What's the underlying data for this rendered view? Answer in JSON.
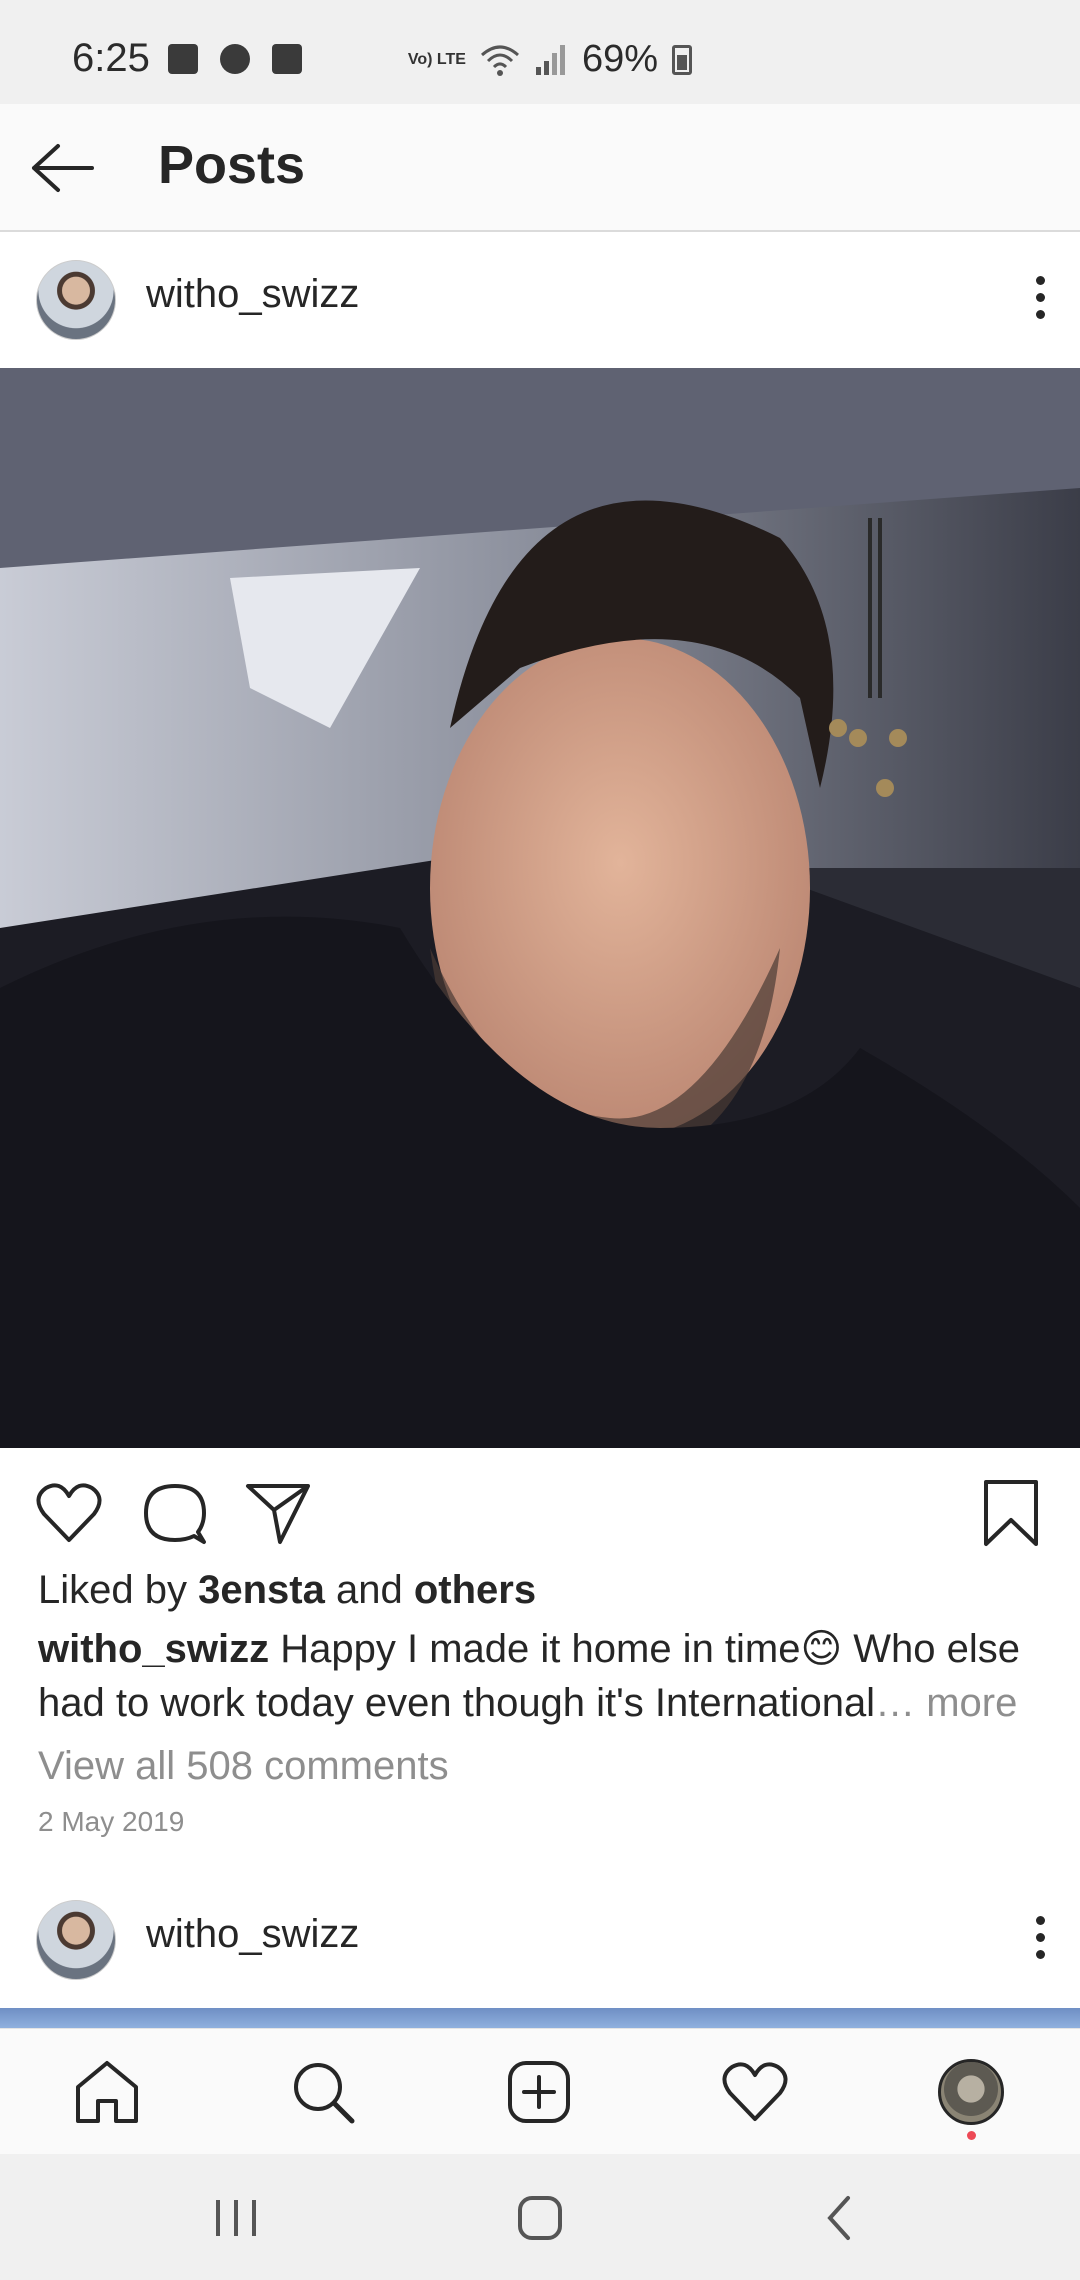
{
  "status_bar": {
    "time": "6:25",
    "volte": "Vo) LTE",
    "battery": "69%"
  },
  "app_bar": {
    "title": "Posts"
  },
  "post": {
    "username": "witho_swizz",
    "liked_by_prefix": "Liked by ",
    "liked_by_user": "3ensta",
    "liked_by_and": " and ",
    "liked_by_others": "others",
    "caption_user": "witho_swizz",
    "caption_text": " Happy I made it home in time😊 Who else had to work today even though it's International",
    "caption_ellipsis": "… more",
    "view_comments": "View all 508 comments",
    "date": "2 May 2019"
  },
  "next_post": {
    "username": "witho_swizz"
  },
  "bottom_nav": {
    "items": [
      "home-icon",
      "search-icon",
      "new-post-icon",
      "activity-heart-icon",
      "profile-avatar"
    ]
  },
  "colors": {
    "accent_notification": "#ed4956",
    "text_primary": "#262626",
    "text_secondary": "#8e8e8e"
  }
}
